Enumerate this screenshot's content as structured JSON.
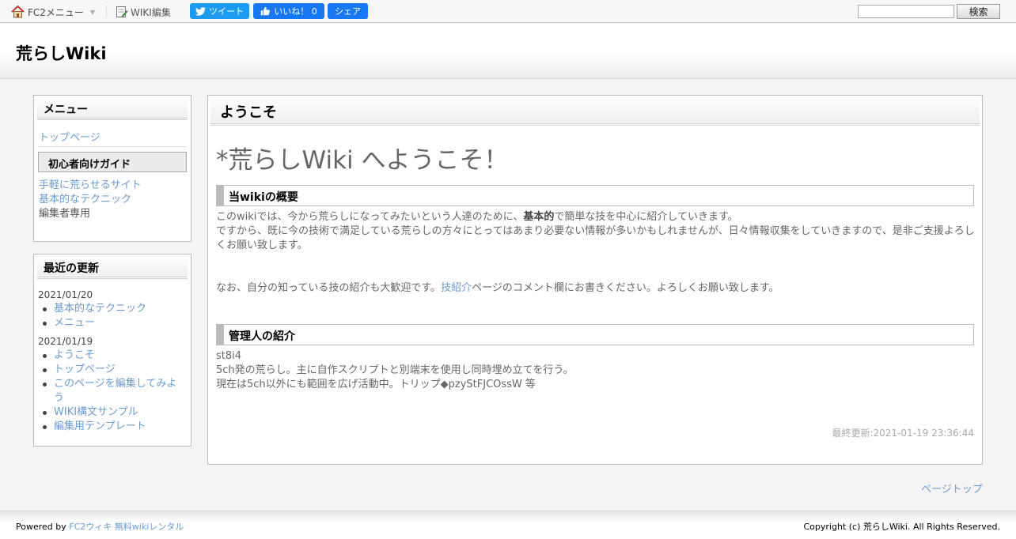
{
  "topbar": {
    "fc2_menu_label": "FC2メニュー",
    "wiki_edit_label": "WIKI編集",
    "tweet_label": "ツイート",
    "like_label": "いいね！ 0",
    "share_label": "シェア",
    "search_value": "",
    "search_button": "検索"
  },
  "header": {
    "site_title": "荒らしWiki"
  },
  "sidebar": {
    "menu_title": "メニュー",
    "top_page": "トップページ",
    "guide_heading": "初心者向けガイド",
    "guide_items": [
      "手軽に荒らせるサイト",
      "基本的なテクニック"
    ],
    "editor_only": "編集者専用",
    "updates_title": "最近の更新",
    "updates": [
      {
        "date": "2021/01/20",
        "items": [
          "基本的なテクニック",
          "メニュー"
        ]
      },
      {
        "date": "2021/01/19",
        "items": [
          "ようこそ",
          "トップページ",
          "このページを編集してみよう",
          "WIKI構文サンプル",
          "編集用テンプレート"
        ]
      }
    ]
  },
  "main": {
    "page_title": "ようこそ",
    "heading": "*荒らしWiki へようこそ！",
    "overview_heading": "当wikiの概要",
    "p1_before": "このwikiでは、今から荒らしになってみたいという人達のために、",
    "p1_bold": "基本的",
    "p1_after": "で簡単な技を中心に紹介していきます。",
    "p2": "ですから、既に今の技術で満足している荒らしの方々にとってはあまり必要ない情報が多いかもしれませんが、日々情報収集をしていきますので、是非ご支援よろしくお願い致します。",
    "p3_before": "なお、自分の知っている技の紹介も大歓迎です。",
    "p3_link": "技紹介",
    "p3_after": "ページのコメント欄にお書きください。よろしくお願い致します。",
    "admin_heading": "管理人の紹介",
    "admin_name": "st8i4",
    "admin_desc1": "5ch発の荒らし。主に自作スクリプトと別端末を使用し同時埋め立てを行う。",
    "admin_desc2": "現在は5ch以外にも範囲を広げ活動中。トリップ◆pzyStFJCOssW 等",
    "last_updated": "最終更新:2021-01-19 23:36:44"
  },
  "page_top": "ページトップ",
  "footer": {
    "powered_prefix": "Powered by",
    "powered_link": "FC2ウィキ 無料wikiレンタル",
    "copyright": "Copyright (c) 荒らしWiki. All Rights Reserved."
  },
  "colors": {
    "link": "#6b9bd1",
    "twitter": "#1d9bf0",
    "facebook": "#1877f2"
  }
}
